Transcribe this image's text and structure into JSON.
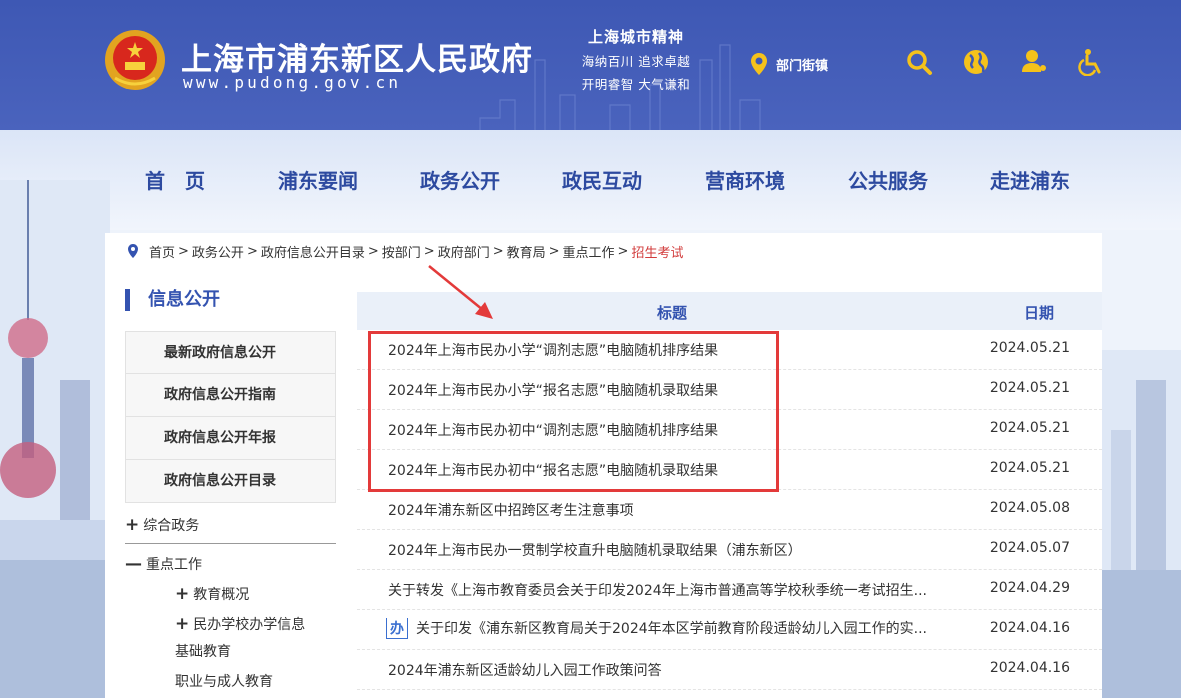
{
  "header": {
    "title": "上海市浦东新区人民政府",
    "domain": "www.pudong.gov.cn",
    "spirit": {
      "line1": "上海城市精神",
      "line2": "海纳百川  追求卓越",
      "line3": "开明睿智  大气谦和"
    },
    "location_label": "部门街镇",
    "icons": [
      "location-pin-icon",
      "search-icon",
      "globe-icon",
      "user-icon",
      "accessibility-icon"
    ]
  },
  "nav": {
    "items": [
      {
        "label": "首　页"
      },
      {
        "label": "浦东要闻"
      },
      {
        "label": "政务公开"
      },
      {
        "label": "政民互动"
      },
      {
        "label": "营商环境"
      },
      {
        "label": "公共服务"
      },
      {
        "label": "走进浦东"
      }
    ]
  },
  "breadcrumb": {
    "items": [
      "首页",
      "政务公开",
      "政府信息公开目录",
      "按部门",
      "政府部门",
      "教育局",
      "重点工作",
      "招生考试"
    ],
    "separator": ">"
  },
  "sidebar": {
    "title": "信息公开",
    "menu": [
      "最新政府信息公开",
      "政府信息公开指南",
      "政府信息公开年报",
      "政府信息公开目录"
    ],
    "tree": {
      "general": {
        "symbol": "+",
        "label": "综合政务"
      },
      "key": {
        "symbol": "—",
        "label": "重点工作"
      },
      "sub": [
        {
          "symbol": "+",
          "label": "教育概况"
        },
        {
          "symbol": "+",
          "label": "民办学校办学信息"
        },
        {
          "symbol": "",
          "label": "基础教育"
        },
        {
          "symbol": "",
          "label": "职业与成人教育"
        }
      ]
    }
  },
  "list": {
    "header_title": "标题",
    "header_date": "日期",
    "badge": "办",
    "items": [
      {
        "title": "2024年上海市民办小学“调剂志愿”电脑随机排序结果",
        "date": "2024.05.21"
      },
      {
        "title": "2024年上海市民办小学“报名志愿”电脑随机录取结果",
        "date": "2024.05.21"
      },
      {
        "title": "2024年上海市民办初中“调剂志愿”电脑随机排序结果",
        "date": "2024.05.21"
      },
      {
        "title": "2024年上海市民办初中“报名志愿”电脑随机录取结果",
        "date": "2024.05.21"
      },
      {
        "title": "2024年浦东新区中招跨区考生注意事项",
        "date": "2024.05.08"
      },
      {
        "title": "2024年上海市民办一贯制学校直升电脑随机录取结果（浦东新区）",
        "date": "2024.05.07"
      },
      {
        "title": "关于转发《上海市教育委员会关于印发2024年上海市普通高等学校秋季统一考试招生...",
        "date": "2024.04.29"
      },
      {
        "title": "关于印发《浦东新区教育局关于2024年本区学前教育阶段适龄幼儿入园工作的实...",
        "date": "2024.04.16"
      },
      {
        "title": "2024年浦东新区适龄幼儿入园工作政策问答",
        "date": "2024.04.16"
      }
    ]
  },
  "colors": {
    "header_bg": "#3e58b4",
    "accent": "#3453b0",
    "highlight": "#e33a3a",
    "breadcrumb_current": "#d23c3c"
  }
}
